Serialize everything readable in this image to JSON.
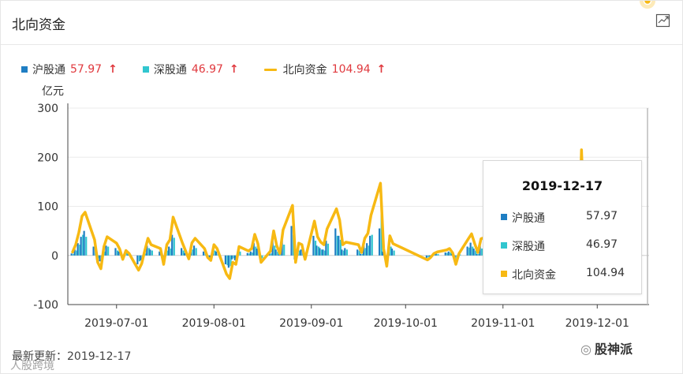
{
  "panel": {
    "title": "北向资金",
    "expand_icon": "chart-expand-icon"
  },
  "legend": {
    "items": [
      {
        "name": "沪股通",
        "value": "57.97",
        "arrow": "↑",
        "color": "#1f7ec3",
        "shape": "square"
      },
      {
        "name": "深股通",
        "value": "46.97",
        "arrow": "↑",
        "color": "#31c6cf",
        "shape": "square"
      },
      {
        "name": "北向资金",
        "value": "104.94",
        "arrow": "↑",
        "color": "#f7b913",
        "shape": "line"
      }
    ]
  },
  "tooltip": {
    "date": "2019-12-17",
    "rows": [
      {
        "name": "沪股通",
        "value": "57.97",
        "color": "#1f7ec3"
      },
      {
        "name": "深股通",
        "value": "46.97",
        "color": "#31c6cf"
      },
      {
        "name": "北向资金",
        "value": "104.94",
        "color": "#f7b913"
      }
    ]
  },
  "footer": {
    "label": "最新更新：",
    "date": "2019-12-17"
  },
  "watermarks": {
    "left": "人股跨境",
    "right": "股神派"
  },
  "chart_data": {
    "type": "bar+line",
    "ylabel": "亿元",
    "ylim": [
      -100,
      300
    ],
    "yticks": [
      300,
      200,
      100,
      0,
      -100
    ],
    "xticks": [
      "2019-07-01",
      "2019-08-01",
      "2019-09-01",
      "2019-10-01",
      "2019-11-01",
      "2019-12-01"
    ],
    "xrange": [
      "2019-06-17",
      "2019-12-17"
    ],
    "colors": {
      "沪股通": "#1f7ec3",
      "深股通": "#31c6cf",
      "北向资金": "#f7b913"
    },
    "dates": [
      "2019-06-17",
      "2019-06-18",
      "2019-06-19",
      "2019-06-20",
      "2019-06-21",
      "2019-06-24",
      "2019-06-25",
      "2019-06-26",
      "2019-06-27",
      "2019-06-28",
      "2019-07-01",
      "2019-07-02",
      "2019-07-03",
      "2019-07-04",
      "2019-07-05",
      "2019-07-08",
      "2019-07-09",
      "2019-07-10",
      "2019-07-11",
      "2019-07-12",
      "2019-07-15",
      "2019-07-16",
      "2019-07-17",
      "2019-07-18",
      "2019-07-19",
      "2019-07-22",
      "2019-07-23",
      "2019-07-24",
      "2019-07-25",
      "2019-07-26",
      "2019-07-29",
      "2019-07-30",
      "2019-07-31",
      "2019-08-01",
      "2019-08-02",
      "2019-08-05",
      "2019-08-06",
      "2019-08-07",
      "2019-08-08",
      "2019-08-09",
      "2019-08-12",
      "2019-08-13",
      "2019-08-14",
      "2019-08-15",
      "2019-08-16",
      "2019-08-19",
      "2019-08-20",
      "2019-08-21",
      "2019-08-22",
      "2019-08-23",
      "2019-08-26",
      "2019-08-27",
      "2019-08-28",
      "2019-08-29",
      "2019-08-30",
      "2019-09-02",
      "2019-09-03",
      "2019-09-04",
      "2019-09-05",
      "2019-09-06",
      "2019-09-09",
      "2019-09-10",
      "2019-09-11",
      "2019-09-12",
      "2019-09-16",
      "2019-09-17",
      "2019-09-18",
      "2019-09-19",
      "2019-09-20",
      "2019-09-23",
      "2019-09-24",
      "2019-09-25",
      "2019-09-26",
      "2019-09-27",
      "2019-10-08",
      "2019-10-09",
      "2019-10-10",
      "2019-10-11",
      "2019-10-14",
      "2019-10-15",
      "2019-10-16",
      "2019-10-17",
      "2019-10-18",
      "2019-10-21",
      "2019-10-22",
      "2019-10-23",
      "2019-10-24",
      "2019-10-25",
      "2019-10-28",
      "2019-10-29",
      "2019-10-30",
      "2019-10-31",
      "2019-11-01",
      "2019-11-04",
      "2019-11-05",
      "2019-11-06",
      "2019-11-07",
      "2019-11-08",
      "2019-11-11",
      "2019-11-12",
      "2019-11-13",
      "2019-11-14",
      "2019-11-15",
      "2019-11-18",
      "2019-11-19",
      "2019-11-20",
      "2019-11-21",
      "2019-11-22",
      "2019-11-25",
      "2019-11-26",
      "2019-11-27",
      "2019-11-28",
      "2019-11-29",
      "2019-12-02",
      "2019-12-03",
      "2019-12-04",
      "2019-12-05",
      "2019-12-06",
      "2019-12-09",
      "2019-12-10",
      "2019-12-11",
      "2019-12-12",
      "2019-12-13",
      "2019-12-16",
      "2019-12-17"
    ],
    "series": [
      {
        "name": "沪股通",
        "values": [
          4,
          12,
          25,
          38,
          50,
          18,
          -8,
          -12,
          10,
          20,
          15,
          8,
          -5,
          5,
          2,
          -18,
          -10,
          6,
          20,
          12,
          8,
          -10,
          12,
          18,
          42,
          15,
          5,
          -4,
          14,
          20,
          8,
          -2,
          -6,
          12,
          8,
          -18,
          -25,
          -8,
          -10,
          10,
          5,
          8,
          25,
          14,
          -8,
          5,
          30,
          12,
          2,
          30,
          60,
          -8,
          15,
          12,
          -4,
          40,
          20,
          15,
          12,
          30,
          55,
          40,
          12,
          15,
          12,
          3,
          20,
          25,
          40,
          55,
          8,
          -12,
          22,
          14,
          -5,
          -2,
          2,
          4,
          6,
          8,
          3,
          -10,
          2,
          18,
          26,
          14,
          3,
          20,
          22,
          6,
          -6,
          8,
          15,
          10,
          -5,
          12,
          18,
          8,
          12,
          16,
          10,
          -6,
          8,
          14,
          20,
          28,
          20,
          50,
          -2,
          120,
          20,
          15,
          10,
          -6,
          8,
          18,
          25,
          32,
          40,
          20,
          -10,
          25,
          58
        ]
      },
      {
        "name": "深股通",
        "values": [
          3,
          10,
          22,
          42,
          38,
          14,
          -6,
          -15,
          8,
          18,
          10,
          5,
          -3,
          5,
          2,
          -12,
          -7,
          4,
          15,
          10,
          6,
          -8,
          10,
          14,
          36,
          10,
          4,
          -3,
          12,
          15,
          6,
          -2,
          -4,
          10,
          6,
          -20,
          -22,
          -6,
          -8,
          8,
          4,
          6,
          18,
          10,
          -6,
          4,
          20,
          8,
          2,
          22,
          42,
          -6,
          10,
          10,
          -4,
          30,
          18,
          12,
          10,
          24,
          40,
          32,
          10,
          12,
          10,
          3,
          15,
          20,
          42,
          92,
          6,
          -10,
          18,
          10,
          -4,
          -2,
          2,
          3,
          5,
          6,
          2,
          -8,
          2,
          16,
          18,
          10,
          3,
          14,
          18,
          4,
          -4,
          6,
          10,
          8,
          -4,
          10,
          14,
          6,
          10,
          12,
          8,
          -4,
          6,
          10,
          14,
          20,
          16,
          38,
          -2,
          95,
          16,
          12,
          8,
          -4,
          6,
          14,
          20,
          25,
          32,
          15,
          -8,
          20,
          47
        ]
      },
      {
        "name": "北向资金",
        "values": [
          7,
          22,
          47,
          80,
          88,
          32,
          -14,
          -27,
          18,
          38,
          25,
          13,
          -8,
          10,
          4,
          -30,
          -17,
          10,
          35,
          22,
          14,
          -18,
          22,
          32,
          78,
          25,
          9,
          -7,
          26,
          35,
          14,
          -4,
          -10,
          22,
          14,
          -38,
          -47,
          -14,
          -18,
          18,
          9,
          14,
          43,
          24,
          -14,
          9,
          50,
          20,
          4,
          52,
          102,
          -14,
          25,
          22,
          -8,
          70,
          38,
          27,
          22,
          54,
          95,
          72,
          22,
          27,
          22,
          6,
          35,
          45,
          82,
          147,
          14,
          -22,
          40,
          24,
          -9,
          -4,
          4,
          7,
          11,
          14,
          5,
          -18,
          4,
          34,
          44,
          24,
          6,
          34,
          40,
          10,
          -10,
          14,
          25,
          18,
          -9,
          22,
          32,
          14,
          22,
          28,
          18,
          -10,
          14,
          24,
          34,
          48,
          36,
          88,
          -4,
          215,
          36,
          27,
          18,
          -10,
          14,
          32,
          45,
          57,
          72,
          35,
          -18,
          45,
          104.94
        ]
      }
    ]
  }
}
